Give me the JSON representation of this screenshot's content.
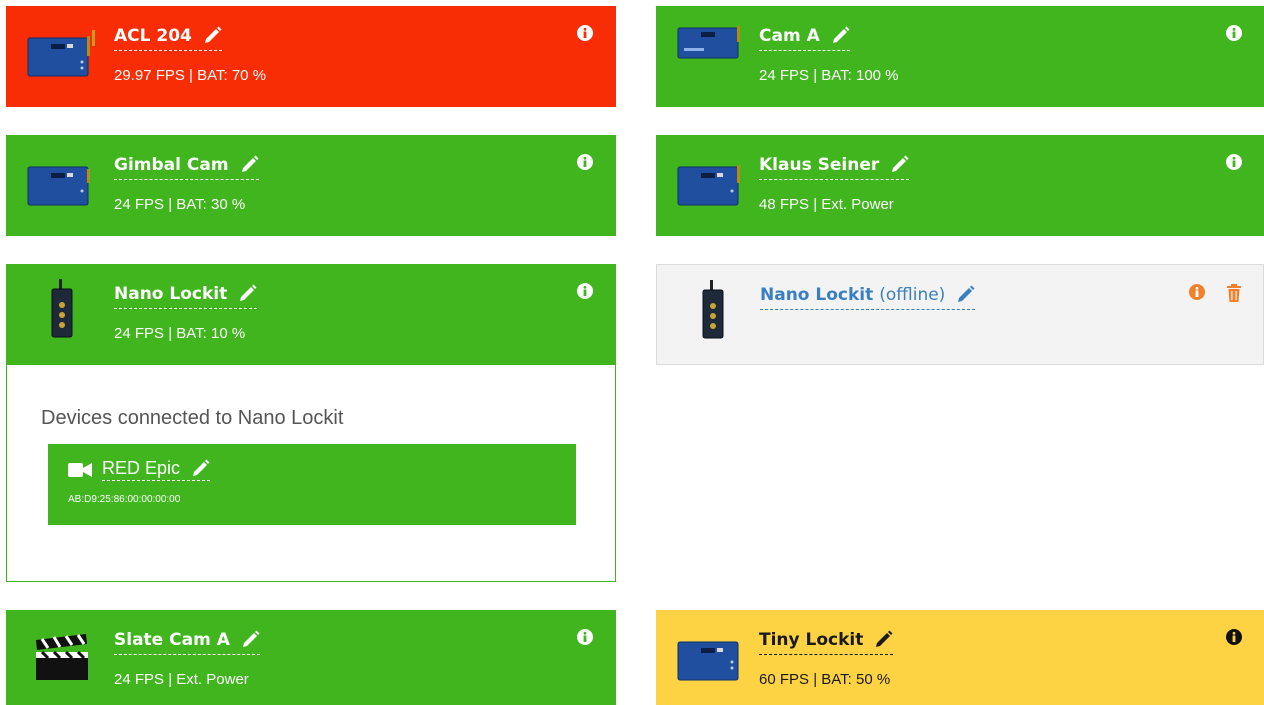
{
  "devices": [
    {
      "name": "ACL 204",
      "status": "29.97 FPS | BAT: 70 %",
      "state": "error",
      "color": "#f82c05",
      "icon": "lockit-box-icon"
    },
    {
      "name": "Cam A",
      "status": "24 FPS | BAT: 100 %",
      "state": "ok",
      "color": "#40b51d",
      "icon": "lockit-box-icon"
    },
    {
      "name": "Gimbal Cam",
      "status": "24 FPS | BAT: 30 %",
      "state": "ok",
      "color": "#40b51d",
      "icon": "lockit-box-icon"
    },
    {
      "name": "Klaus Seiner",
      "status": "48 FPS | Ext. Power",
      "state": "ok",
      "color": "#40b51d",
      "icon": "lockit-box-icon"
    },
    {
      "name": "Nano Lockit",
      "status": "24 FPS | BAT: 10 %",
      "state": "ok",
      "color": "#40b51d",
      "icon": "nano-lockit-icon",
      "expanded": true
    },
    {
      "name": "Nano Lockit",
      "suffix": "(offline)",
      "state": "offline",
      "color": "#f3f3f3",
      "icon": "nano-lockit-icon"
    },
    {
      "name": "Slate Cam A",
      "status": "24 FPS | Ext. Power",
      "state": "ok",
      "color": "#40b51d",
      "icon": "clapperboard-icon"
    },
    {
      "name": "Tiny Lockit",
      "status": "60 FPS | BAT: 50 %",
      "state": "warning",
      "color": "#fdd343",
      "icon": "lockit-box-icon"
    }
  ],
  "connected": {
    "title": "Devices connected to Nano Lockit",
    "items": [
      {
        "name": "RED Epic",
        "mac": "AB:D9:25:86:00:00:00:00",
        "icon": "video-camera-icon"
      }
    ]
  },
  "colors": {
    "ok": "#40b51d",
    "error": "#f82c05",
    "warning": "#fdd343",
    "offline_bg": "#f3f3f3",
    "offline_text": "#3a7fc1",
    "info_offline": "#f0812a",
    "trash": "#f0812a"
  }
}
